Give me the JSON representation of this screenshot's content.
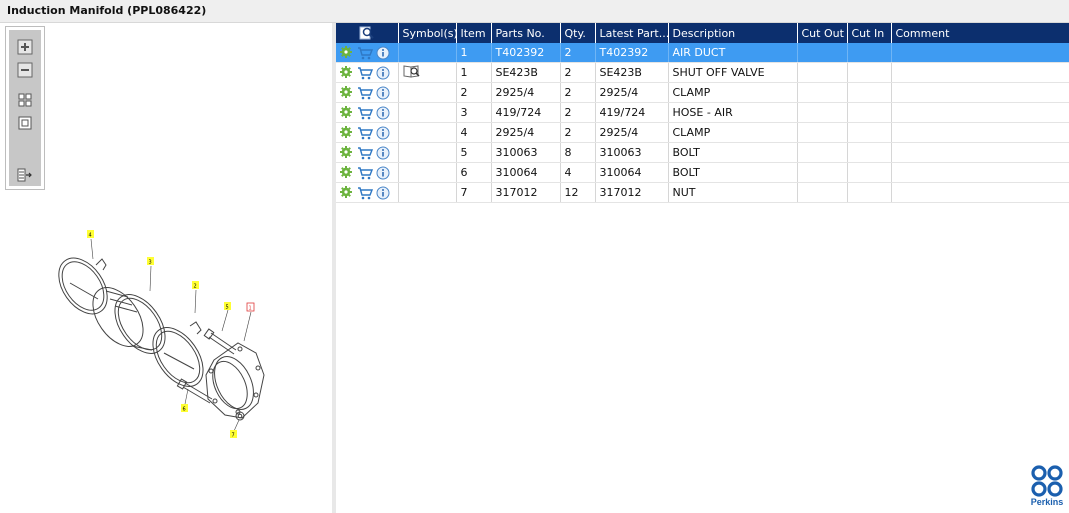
{
  "window": {
    "title": "Induction Manifold (PPL086422)"
  },
  "toolbar": {
    "zoom_in_icon": "plus-icon",
    "zoom_out_icon": "minus-icon",
    "fit_icon": "grid-icon",
    "reset_icon": "square-icon",
    "export_icon": "list-export-icon"
  },
  "table": {
    "headers": {
      "actions": "",
      "symbols": "Symbol(s)",
      "item": "Item",
      "parts_no": "Parts No.",
      "qty": "Qty.",
      "latest_part": "Latest Part...",
      "description": "Description",
      "cut_out": "Cut Out",
      "cut_in": "Cut In",
      "comment": "Comment"
    },
    "rows": [
      {
        "item": "1",
        "parts_no": "T402392",
        "qty": "2",
        "latest_part": "T402392",
        "description": "AIR DUCT",
        "cut_out": "",
        "cut_in": "",
        "comment": "",
        "symbol": ""
      },
      {
        "item": "1",
        "parts_no": "SE423B",
        "qty": "2",
        "latest_part": "SE423B",
        "description": "SHUT OFF VALVE",
        "cut_out": "",
        "cut_in": "",
        "comment": "",
        "symbol": "magnifier-book-icon"
      },
      {
        "item": "2",
        "parts_no": "2925/4",
        "qty": "2",
        "latest_part": "2925/4",
        "description": "CLAMP",
        "cut_out": "",
        "cut_in": "",
        "comment": "",
        "symbol": ""
      },
      {
        "item": "3",
        "parts_no": "419/724",
        "qty": "2",
        "latest_part": "419/724",
        "description": "HOSE - AIR",
        "cut_out": "",
        "cut_in": "",
        "comment": "",
        "symbol": ""
      },
      {
        "item": "4",
        "parts_no": "2925/4",
        "qty": "2",
        "latest_part": "2925/4",
        "description": "CLAMP",
        "cut_out": "",
        "cut_in": "",
        "comment": "",
        "symbol": ""
      },
      {
        "item": "5",
        "parts_no": "310063",
        "qty": "8",
        "latest_part": "310063",
        "description": "BOLT",
        "cut_out": "",
        "cut_in": "",
        "comment": "",
        "symbol": ""
      },
      {
        "item": "6",
        "parts_no": "310064",
        "qty": "4",
        "latest_part": "310064",
        "description": "BOLT",
        "cut_out": "",
        "cut_in": "",
        "comment": "",
        "symbol": ""
      },
      {
        "item": "7",
        "parts_no": "317012",
        "qty": "12",
        "latest_part": "317012",
        "description": "NUT",
        "cut_out": "",
        "cut_in": "",
        "comment": "",
        "symbol": ""
      }
    ],
    "selected_row": 0
  },
  "diagram": {
    "callouts": [
      "4",
      "3",
      "2",
      "5",
      "1",
      "6",
      "7"
    ]
  },
  "brand": {
    "name": "Perkins",
    "color": "#1b5fae"
  },
  "colors": {
    "header_bg": "#0c2f6e",
    "selected_bg": "#3e9bf2"
  }
}
